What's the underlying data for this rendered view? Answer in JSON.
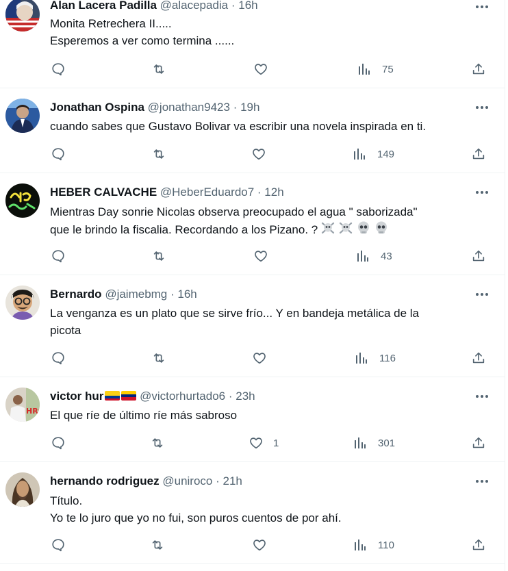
{
  "colors": {
    "text": "#0f1419",
    "secondary": "#536471",
    "divider": "#eff3f4"
  },
  "tweets": [
    {
      "name": "Alan Lacera Padilla",
      "handle": "@alacepadia",
      "sep": " · ",
      "time": "16h",
      "lines": [
        "Monita Retrechera II.....",
        "Esperemos a ver como termina ......"
      ],
      "likes": "",
      "views": "75"
    },
    {
      "name": "Jonathan Ospina",
      "handle": "@jonathan9423",
      "sep": " · ",
      "time": "19h",
      "lines": [
        "cuando sabes que Gustavo Bolivar va escribir una novela inspirada en ti."
      ],
      "likes": "",
      "views": "149"
    },
    {
      "name": "HEBER CALVACHE",
      "handle": "@HeberEduardo7",
      "sep": " · ",
      "time": "12h",
      "lines": [
        "Mientras Day sonrie  Nicolas observa preocupado el agua \" saborizada\"",
        "que le brindo la fiscalia. Recordando a los Pizano. ?"
      ],
      "likes": "",
      "views": "43"
    },
    {
      "name": "Bernardo",
      "handle": "@jaimebmg",
      "sep": " · ",
      "time": "16h",
      "lines": [
        "La venganza es un plato que se sirve frío... Y en bandeja metálica de la",
        "picota"
      ],
      "likes": "",
      "views": "116"
    },
    {
      "name": "victor hur",
      "handle": "@victorhurtado6",
      "sep": " · ",
      "time": "23h",
      "lines": [
        "El que ríe de último ríe más sabroso"
      ],
      "likes": "1",
      "views": "301"
    },
    {
      "name": "hernando rodriguez",
      "handle": "@uniroco",
      "sep": " · ",
      "time": "21h",
      "lines": [
        "Título.",
        "Yo te lo juro que yo no fui, son puros cuentos de por ahí."
      ],
      "likes": "",
      "views": "110"
    }
  ],
  "icons": {
    "reply": "reply-icon",
    "retweet": "retweet-icon",
    "like": "heart-icon",
    "views": "views-chart-icon",
    "share": "share-icon",
    "more": "more-icon",
    "flags": [
      "colombia-flag",
      "venezuela-flag"
    ],
    "emoji": [
      "skull-crossbones-emoji",
      "skull-emoji"
    ]
  }
}
